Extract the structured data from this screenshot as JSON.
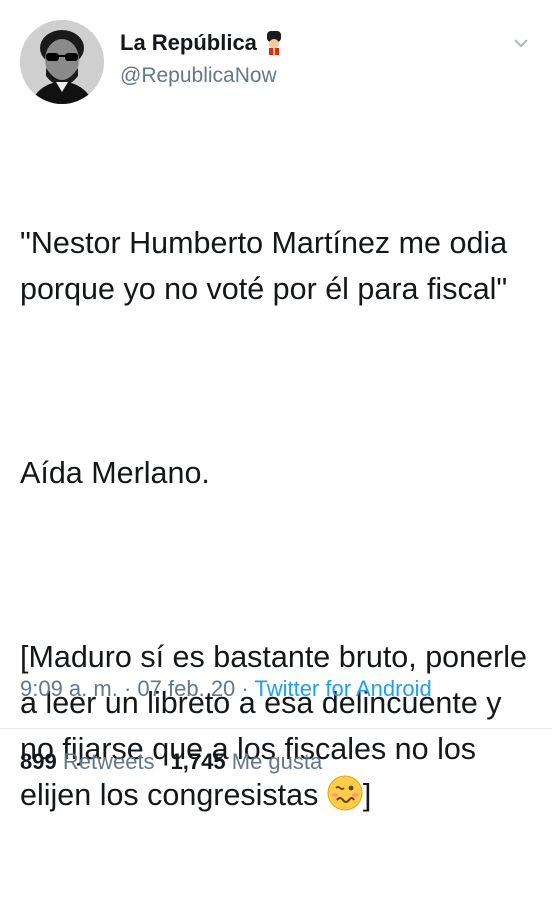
{
  "tweet": {
    "display_name": "La República",
    "handle": "@RepublicaNow",
    "paragraphs": [
      "\"Nestor Humberto Martínez me odia porque yo no voté por él para fiscal\"",
      "Aída Merlano.",
      "[Maduro sí es bastante bruto, ponerle a leer un libreto a esa delincuente y no fijarse que a los fiscales no los elijen los congresistas"
    ],
    "closing_bracket": "]",
    "time": "9:09 a. m.",
    "date": "07 feb. 20",
    "source": "Twitter for Android",
    "retweets_count": "899",
    "retweets_label": "Retweets",
    "likes_count": "1,745",
    "likes_label": "Me gusta"
  },
  "icons": {
    "avatar": "avatar-sunglasses-portrait",
    "badge": "guard-emoji-icon",
    "chevron": "chevron-down-icon",
    "emoji": "woozy-face-emoji"
  },
  "colors": {
    "text": "#14171a",
    "secondary": "#657786",
    "link": "#1da1f2",
    "divider": "#e6ecf0"
  }
}
